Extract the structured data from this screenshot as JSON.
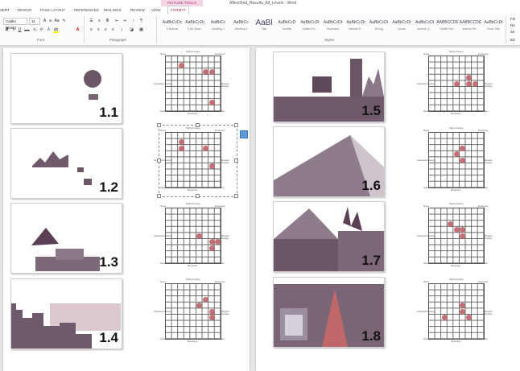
{
  "window": {
    "title": "AffectGrid_Results_All_Levels - Word",
    "context_tab": "PICTURE TOOLS"
  },
  "tabs": [
    "SERT",
    "DESIGN",
    "PAGE LAYOUT",
    "REFERENCES",
    "MAILINGS",
    "REVIEW",
    "VIEW",
    "FORMAT"
  ],
  "active_tab": "FORMAT",
  "ribbon": {
    "font_name": "Calibri (Body)",
    "font_size": "11",
    "bold": "B",
    "italic": "I",
    "underline": "U",
    "strike": "abc",
    "font_color": "A",
    "pilcrow": "¶",
    "groups": {
      "font": "Font",
      "paragraph": "Paragraph",
      "styles": "Styles"
    },
    "styles": [
      {
        "sample": "AaBbCcDc",
        "name": "¶ Normal"
      },
      {
        "sample": "AaBbCcDc",
        "name": "¶ No Spac..."
      },
      {
        "sample": "AaBbCc",
        "name": "Heading 1"
      },
      {
        "sample": "AaBbCc",
        "name": "Heading 2"
      },
      {
        "sample": "AaBl",
        "name": "Title",
        "big": true
      },
      {
        "sample": "AaBbCcD",
        "name": "Subtitle"
      },
      {
        "sample": "AaBbCcDt",
        "name": "Subtle Em..."
      },
      {
        "sample": "AaBbCcDt",
        "name": "Emphasis"
      },
      {
        "sample": "AaBbCcDt",
        "name": "Intense E..."
      },
      {
        "sample": "AaBbCcDt",
        "name": "Strong"
      },
      {
        "sample": "AaBbCcDt",
        "name": "Quote"
      },
      {
        "sample": "AaBbCcDt",
        "name": "Intense Q..."
      },
      {
        "sample": "AABBCCDE",
        "name": "Subtle Ref..."
      },
      {
        "sample": "AABBCCDE",
        "name": "Intense Re..."
      },
      {
        "sample": "AaBbCcDt",
        "name": "Book Title"
      }
    ],
    "side_commands": [
      "Fin",
      "Re",
      "Se",
      "Ed"
    ]
  },
  "grid_labels": {
    "top": "Highly Arousing",
    "bottom": "Sleepiness",
    "left": "Unpleasant Feelings",
    "right": "Pleasant Feelings",
    "top_left": "Stress",
    "top_right": "Excitement",
    "bottom_left": "Depression",
    "bottom_right": "Relaxation"
  },
  "levels": [
    {
      "label": "1.1",
      "dots": [
        [
          2,
          1
        ],
        [
          6,
          2
        ],
        [
          7,
          2
        ],
        [
          7,
          7
        ]
      ]
    },
    {
      "label": "1.2",
      "dots": [
        [
          2,
          1
        ],
        [
          2,
          2
        ],
        [
          6,
          2
        ],
        [
          7,
          5
        ]
      ]
    },
    {
      "label": "1.3",
      "dots": [
        [
          5,
          4
        ],
        [
          7,
          5
        ],
        [
          8,
          5
        ],
        [
          7,
          6
        ]
      ]
    },
    {
      "label": "1.4",
      "dots": [
        [
          6,
          2
        ],
        [
          5,
          3
        ],
        [
          7,
          4
        ],
        [
          7,
          5
        ]
      ]
    },
    {
      "label": "1.5",
      "dots": [
        [
          4,
          4
        ],
        [
          6,
          3
        ],
        [
          6,
          4
        ],
        [
          7,
          4
        ]
      ]
    },
    {
      "label": "1.6",
      "dots": [
        [
          5,
          2
        ],
        [
          4,
          3
        ],
        [
          5,
          4
        ]
      ]
    },
    {
      "label": "1.7",
      "dots": [
        [
          3,
          2
        ],
        [
          4,
          3
        ],
        [
          5,
          3
        ],
        [
          5,
          4
        ]
      ]
    },
    {
      "label": "1.8",
      "dots": [
        [
          2,
          5
        ],
        [
          5,
          3
        ],
        [
          5,
          4
        ],
        [
          6,
          5
        ]
      ]
    }
  ]
}
